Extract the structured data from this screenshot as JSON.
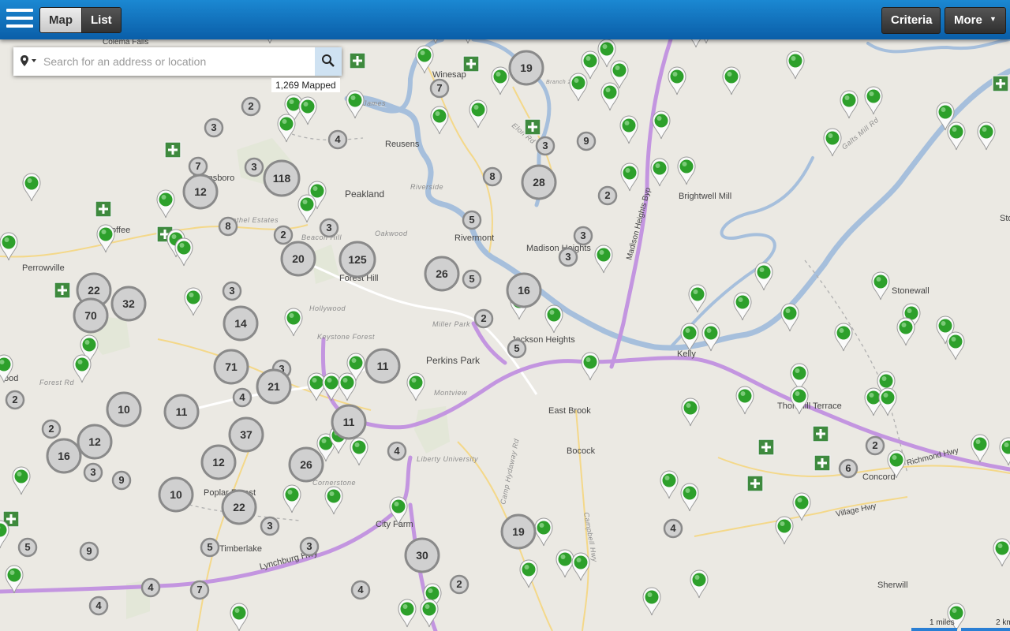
{
  "topbar": {
    "menu_icon": "hamburger-icon",
    "view_map": "Map",
    "view_list": "List",
    "criteria": "Criteria",
    "more": "More",
    "more_icon": "caret-down-icon"
  },
  "search": {
    "placeholder": "Search for an address or location",
    "location_icon": "map-marker-icon",
    "dropdown_icon": "caret-down-icon",
    "button_icon": "magnifier-icon"
  },
  "mapped_count": "1,269 Mapped",
  "scale_labels": [
    "1 miles",
    "2 km"
  ],
  "colors": {
    "topbar": "#0a5ea8",
    "pin_green": "#2da02b",
    "cluster_gray": "#d0d0d0",
    "river": "#9db9d9",
    "highway": "#b98bd6"
  },
  "places": [
    {
      "name": "Colema Falls"
    },
    {
      "name": "Winesap"
    },
    {
      "name": "Branch 29"
    },
    {
      "name": "Reusens"
    },
    {
      "name": "Peakland"
    },
    {
      "name": "Boonsboro"
    },
    {
      "name": "Coffee"
    },
    {
      "name": "Perrowville"
    },
    {
      "name": "Rivermont"
    },
    {
      "name": "Madison Heights"
    },
    {
      "name": "Brightwell Mill"
    },
    {
      "name": "Forest Hill"
    },
    {
      "name": "Perkins Park"
    },
    {
      "name": "Jackson Heights"
    },
    {
      "name": "Kelly"
    },
    {
      "name": "Stonewall"
    },
    {
      "name": "East Brook"
    },
    {
      "name": "Bocock"
    },
    {
      "name": "Concord"
    },
    {
      "name": "City Farm"
    },
    {
      "name": "Sherwill"
    },
    {
      "name": "Poplar Forest"
    },
    {
      "name": "Timberlake"
    },
    {
      "name": "Thornhill Terrace"
    },
    {
      "name": "Richmond Hwy"
    },
    {
      "name": "Village Hwy"
    },
    {
      "name": "Lynchburg Hwy"
    },
    {
      "name": "Madison Heights Byp"
    },
    {
      "name": "James"
    },
    {
      "name": "Elon Rd"
    },
    {
      "name": "Galts Mill Rd"
    },
    {
      "name": "Camp Hydaway Rd"
    },
    {
      "name": "Campbell Hwy"
    },
    {
      "name": "Forest Rd"
    },
    {
      "name": "Oakwood"
    },
    {
      "name": "Riverside"
    },
    {
      "name": "Hollywood"
    },
    {
      "name": "Keystone Forest"
    },
    {
      "name": "Miller Park"
    },
    {
      "name": "Montview"
    },
    {
      "name": "Liberty University"
    },
    {
      "name": "Cornerstone"
    },
    {
      "name": "Beacon Hill"
    },
    {
      "name": "Bethel Estates"
    },
    {
      "name": "Sto"
    },
    {
      "name": "ood"
    }
  ],
  "clusters": [
    {
      "count": 19
    },
    {
      "count": 7
    },
    {
      "count": 2
    },
    {
      "count": 3
    },
    {
      "count": 4
    },
    {
      "count": 9
    },
    {
      "count": 3
    },
    {
      "count": 7
    },
    {
      "count": 3
    },
    {
      "count": 118
    },
    {
      "count": 12
    },
    {
      "count": 28
    },
    {
      "count": 8
    },
    {
      "count": 2
    },
    {
      "count": 8
    },
    {
      "count": 2
    },
    {
      "count": 3
    },
    {
      "count": 5
    },
    {
      "count": 3
    },
    {
      "count": 20
    },
    {
      "count": 125
    },
    {
      "count": 26
    },
    {
      "count": 5
    },
    {
      "count": 16
    },
    {
      "count": 3
    },
    {
      "count": 22
    },
    {
      "count": 32
    },
    {
      "count": 70
    },
    {
      "count": 3
    },
    {
      "count": 14
    },
    {
      "count": 2
    },
    {
      "count": 5
    },
    {
      "count": 71
    },
    {
      "count": 3
    },
    {
      "count": 21
    },
    {
      "count": 11
    },
    {
      "count": 4
    },
    {
      "count": 2
    },
    {
      "count": 10
    },
    {
      "count": 11
    },
    {
      "count": 2
    },
    {
      "count": 12
    },
    {
      "count": 37
    },
    {
      "count": 11
    },
    {
      "count": 16
    },
    {
      "count": 3
    },
    {
      "count": 9
    },
    {
      "count": 12
    },
    {
      "count": 4
    },
    {
      "count": 26
    },
    {
      "count": 10
    },
    {
      "count": 22
    },
    {
      "count": 3
    },
    {
      "count": 5
    },
    {
      "count": 9
    },
    {
      "count": 5
    },
    {
      "count": 3
    },
    {
      "count": 19
    },
    {
      "count": 30
    },
    {
      "count": 4
    },
    {
      "count": 7
    },
    {
      "count": 4
    },
    {
      "count": 4
    },
    {
      "count": 2
    },
    {
      "count": 4
    },
    {
      "count": 2
    },
    {
      "count": 6
    }
  ],
  "listing_pins": 90,
  "zoom_in_markers": 12
}
